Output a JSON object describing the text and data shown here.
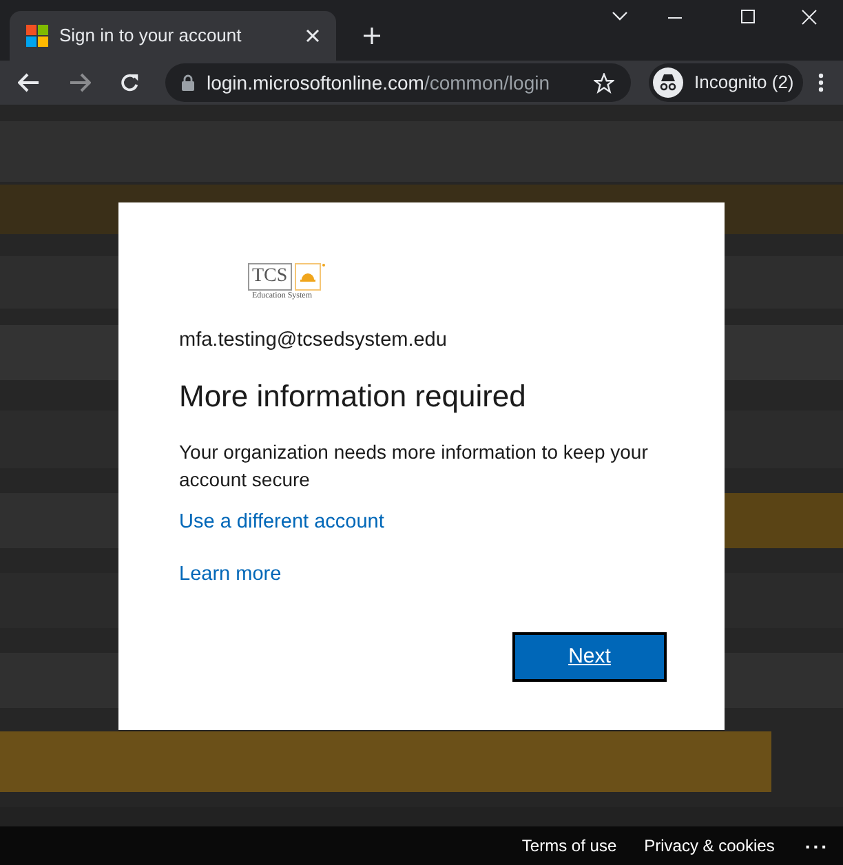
{
  "browser": {
    "tab": {
      "title": "Sign in to your account",
      "selected": true
    },
    "address": {
      "domain": "login.microsoftonline.com",
      "path": "/common/login"
    },
    "profile": {
      "label": "Incognito (2)"
    }
  },
  "card": {
    "logo": {
      "name": "TCS",
      "tagline": "Education System"
    },
    "email": "mfa.testing@tcsedsystem.edu",
    "heading": "More information required",
    "message": "Your organization needs more information to keep your account secure",
    "links": [
      "Use a different account",
      "Learn more"
    ],
    "button": "Next"
  },
  "footer": {
    "links": [
      "Terms of use",
      "Privacy & cookies"
    ],
    "more": "..."
  }
}
